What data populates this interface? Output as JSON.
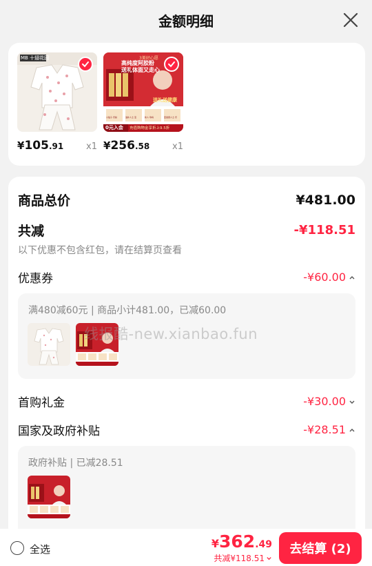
{
  "header": {
    "title": "金额明细"
  },
  "products": [
    {
      "price_currency": "¥",
      "price_int": "105",
      "price_dec": ".91",
      "qty": "x1"
    },
    {
      "price_currency": "¥",
      "price_int": "256",
      "price_dec": ".58",
      "qty": "x1"
    }
  ],
  "thumb_text": {
    "brand1": "MB 十翅花园",
    "p2_top": "3美好心愿",
    "p2_headline1": "高纯度阿胶粉",
    "p2_headline2": "送礼体面又走心",
    "p2_gift": "送礼送健康",
    "p2_tags": [
      "小贴子·乐龄",
      "滋补人士·宝",
      "新人·孕妈",
      "亚健康人士·乐"
    ],
    "p2_ribbon_left": "0元入会",
    "p2_ribbon_right": "充值购物金享折上9.5折"
  },
  "summary": {
    "total_label": "商品总价",
    "total_value": "¥481.00",
    "reduce_label": "共减",
    "reduce_value": "-¥118.51",
    "reduce_note": "以下优惠不包含红包，请在结算页查看",
    "coupon_label": "优惠券",
    "coupon_value": "-¥60.00",
    "coupon_desc": "满480减60元 | 商品小计481.00，已减60.00",
    "first_gift_label": "首购礼金",
    "first_gift_value": "-¥30.00",
    "subsidy_label": "国家及政府补贴",
    "subsidy_value": "-¥28.51",
    "subsidy_desc": "政府补贴 | 已减28.51"
  },
  "watermark": "线报酷-new.xianbao.fun",
  "footer": {
    "select_all": "全选",
    "price_currency": "¥",
    "price_int": "362",
    "price_dec": ".49",
    "saved_text": "共减¥118.51",
    "checkout_label": "去结算 (2)"
  },
  "colors": {
    "accent": "#ff2442",
    "page_bg": "#f2f2f2",
    "card_bg": "#ffffff"
  }
}
